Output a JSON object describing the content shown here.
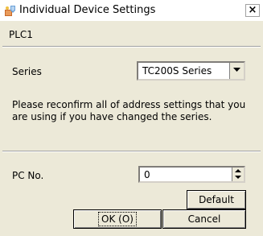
{
  "window": {
    "title": "Individual Device Settings",
    "close_label": "×",
    "icon": "device-settings-icon"
  },
  "device": {
    "name": "PLC1"
  },
  "series": {
    "label": "Series",
    "value": "TC200S Series"
  },
  "note": "Please reconfirm all of address settings that you are using if you have changed the series.",
  "pc_no": {
    "label": "PC No.",
    "value": "0"
  },
  "buttons": {
    "default": "Default",
    "ok": "OK (O)",
    "cancel": "Cancel"
  }
}
